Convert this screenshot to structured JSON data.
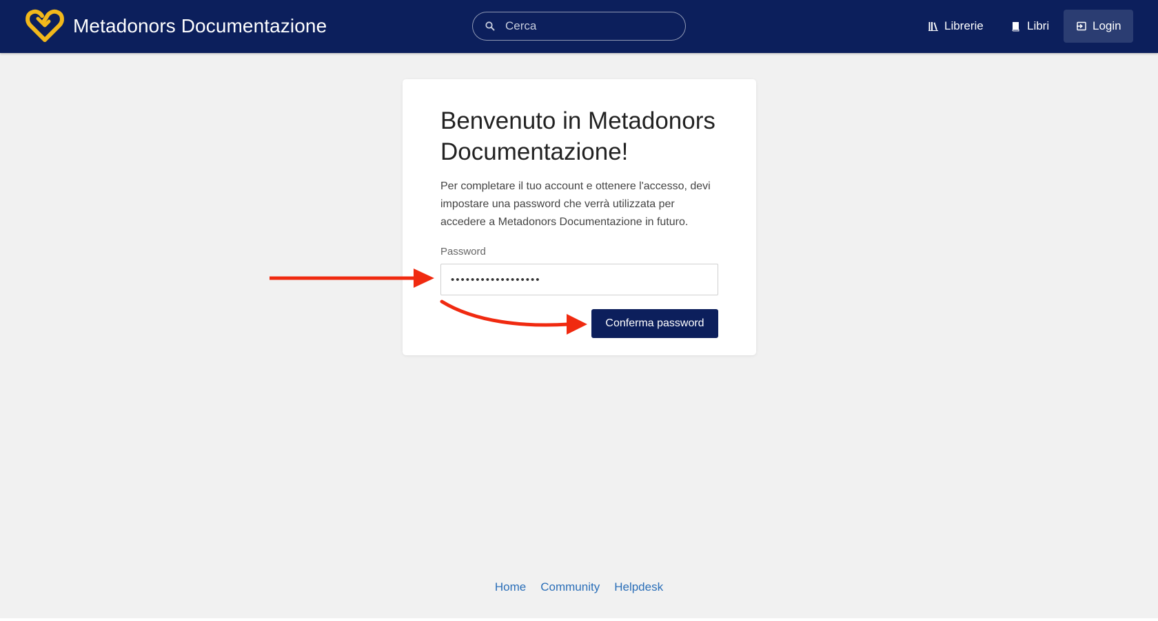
{
  "header": {
    "app_title": "Metadonors Documentazione",
    "logo_icon": "heart-logo-icon",
    "search": {
      "placeholder": "Cerca",
      "value": ""
    },
    "nav": {
      "librerie": "Librerie",
      "libri": "Libri",
      "login": "Login"
    }
  },
  "card": {
    "title": "Benvenuto in Metadonors Documentazione!",
    "description": "Per completare il tuo account e ottenere l'accesso, devi impostare una password che verrà utilizzata per accedere a Metadonors Documentazione in futuro.",
    "password_label": "Password",
    "password_value": "••••••••••••••••••",
    "confirm_button": "Conferma password"
  },
  "footer": {
    "links": [
      "Home",
      "Community",
      "Helpdesk"
    ]
  },
  "colors": {
    "header_bg": "#0c1f5c",
    "logo": "#f2b81b",
    "link": "#2a6eb8",
    "annotation_arrow": "#f02a10"
  }
}
